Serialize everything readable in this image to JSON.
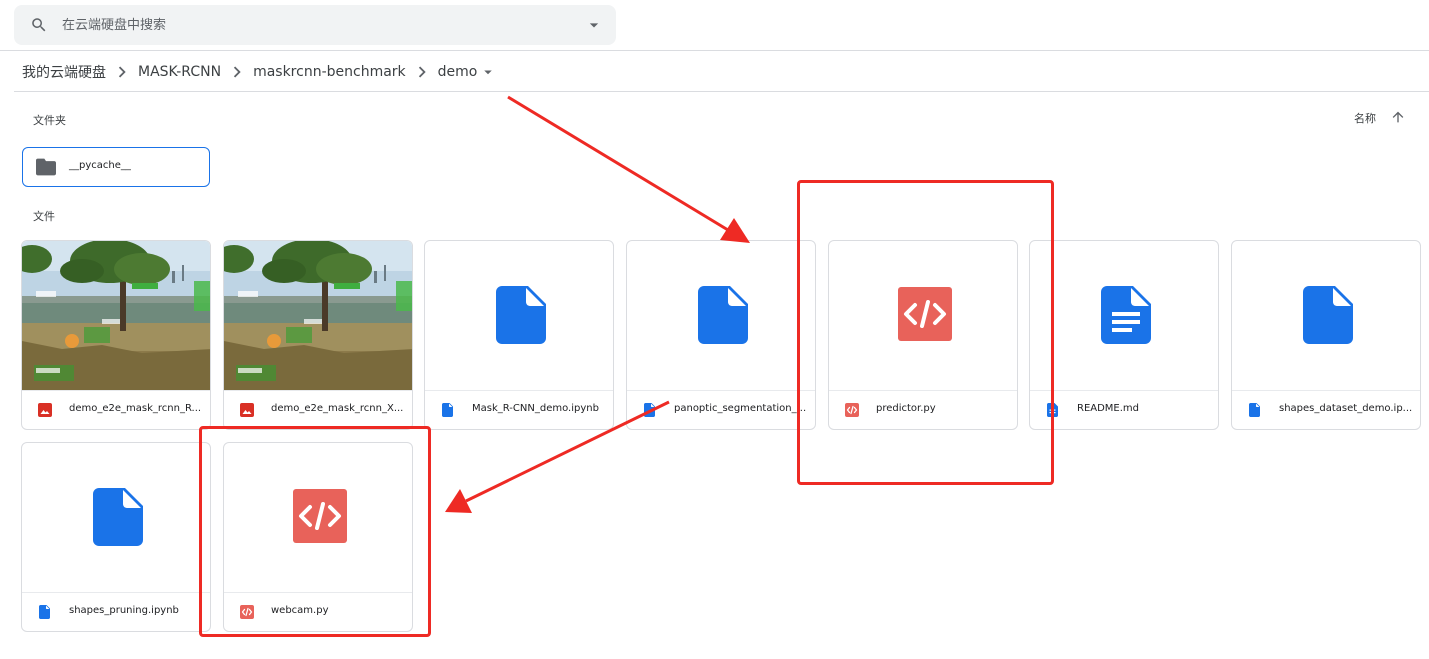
{
  "search": {
    "placeholder": "在云端硬盘中搜索"
  },
  "breadcrumb": [
    "我的云端硬盘",
    "MASK-RCNN",
    "maskrcnn-benchmark",
    "demo"
  ],
  "sections": {
    "folders_label": "文件夹",
    "files_label": "文件"
  },
  "sort": {
    "label": "名称"
  },
  "folders": [
    {
      "name": "__pycache__"
    }
  ],
  "files": [
    {
      "name": "demo_e2e_mask_rcnn_R...",
      "type": "image"
    },
    {
      "name": "demo_e2e_mask_rcnn_X...",
      "type": "image"
    },
    {
      "name": "Mask_R-CNN_demo.ipynb",
      "type": "notebook"
    },
    {
      "name": "panoptic_segmentation_...",
      "type": "notebook"
    },
    {
      "name": "predictor.py",
      "type": "code"
    },
    {
      "name": "README.md",
      "type": "document"
    },
    {
      "name": "shapes_dataset_demo.ip...",
      "type": "notebook"
    },
    {
      "name": "shapes_pruning.ipynb",
      "type": "notebook"
    },
    {
      "name": "webcam.py",
      "type": "code"
    }
  ],
  "colors": {
    "blue_file": "#1a73e8",
    "code_red": "#e8625a",
    "annotation_red": "#ee2a24",
    "selection_blue": "#1a73e8"
  },
  "icons": {
    "search": "search-icon",
    "dropdown": "caret-down-icon",
    "separator": "chevron-right-icon",
    "folder": "folder-icon",
    "sort": "arrow-up-icon"
  }
}
